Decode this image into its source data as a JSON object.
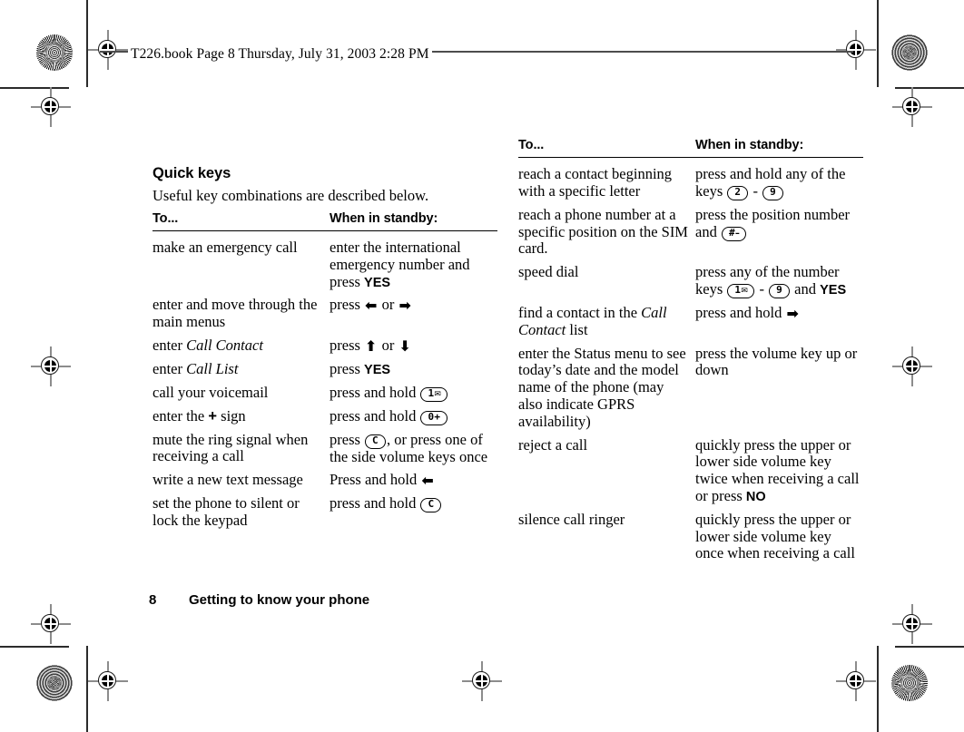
{
  "scan_header": "T226.book  Page 8  Thursday, July 31, 2003  2:28 PM",
  "section": {
    "title": "Quick keys",
    "intro": "Useful key combinations are described below."
  },
  "table_headers": {
    "col1": "To...",
    "col2": "When in standby:"
  },
  "left_table": {
    "rows": [
      {
        "action": "make an emergency call",
        "result_pre": "enter the international emergency number and press ",
        "result_bold": "YES",
        "result_post": ""
      },
      {
        "action": "enter and move through the main menus",
        "result_pre": "press ",
        "arrow1": "⬅",
        "mid": " or ",
        "arrow2": "➡"
      },
      {
        "action_pre": "enter ",
        "action_italic": "Call Contact",
        "result_pre": "press ",
        "arrow1": "⬆",
        "mid": " or ",
        "arrow2": "⬇"
      },
      {
        "action_pre": "enter ",
        "action_italic": "Call List",
        "result_pre": "press ",
        "result_bold": "YES"
      },
      {
        "action": "call your voicemail",
        "result_pre": "press and hold ",
        "key": "1",
        "key_icon": "voicemail-key"
      },
      {
        "action_pre": "enter the ",
        "action_bold": "+",
        "action_post": " sign",
        "result_pre": "press and hold ",
        "key": "0+"
      },
      {
        "action": "mute the ring signal when receiving a call",
        "result_pre": "press ",
        "key": "C",
        "result_post": ", or press one of the side volume keys once"
      },
      {
        "action": "write a new text message",
        "result_pre": "Press and hold ",
        "arrow1": "⬅"
      },
      {
        "action": "set the phone to silent or lock the keypad",
        "result_pre": "press and hold ",
        "key": "C"
      }
    ]
  },
  "right_table": {
    "rows": [
      {
        "action": "reach a contact beginning with a specific letter",
        "result_pre": "press and hold any of the keys ",
        "key": "2",
        "sep": " - ",
        "key2": "9"
      },
      {
        "action": "reach a phone number at a specific position on the SIM card.",
        "result_pre": "press the position number and ",
        "key": "#"
      },
      {
        "action": "speed dial",
        "result_pre": "press any of the number keys ",
        "key": "1",
        "key_icon": "voicemail-key",
        "sep": " - ",
        "key2": "9",
        "result_mid": " and ",
        "result_bold": "YES"
      },
      {
        "action_pre": "find a contact in the ",
        "action_italic": "Call Contact",
        "action_post": " list",
        "result_pre": "press and hold ",
        "arrow1": "➡"
      },
      {
        "action": "enter the Status menu to see today’s date and the model name of the phone (may also indicate GPRS availability)",
        "result_pre": "press the volume key up or down"
      },
      {
        "action": "reject a call",
        "result_pre": "quickly press the upper or lower side volume key twice when receiving a call or press ",
        "result_bold": "NO"
      },
      {
        "action": "silence call ringer",
        "result_pre": "quickly press the upper or lower side volume key once when receiving a call"
      }
    ]
  },
  "footer": {
    "page_number": "8",
    "chapter": "Getting to know your phone"
  }
}
